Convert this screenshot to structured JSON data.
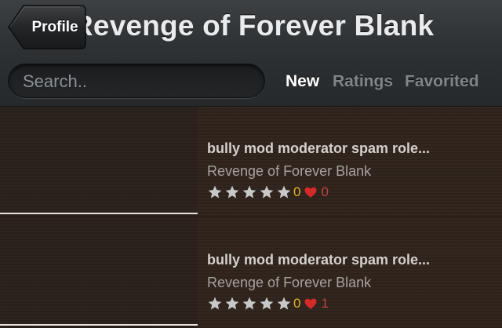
{
  "header": {
    "title": "Revenge of Forever Blank",
    "back_label": "Profile"
  },
  "search": {
    "placeholder": "Search.."
  },
  "tabs": [
    {
      "label": "New",
      "active": true
    },
    {
      "label": "Ratings",
      "active": false
    },
    {
      "label": "Favorited",
      "active": false
    }
  ],
  "items": [
    {
      "title": "bully mod moderator spam role...",
      "subtitle": "Revenge of Forever Blank",
      "stars": 5,
      "rating_count": "0",
      "favorites": "0"
    },
    {
      "title": "bully mod moderator spam role...",
      "subtitle": "Revenge of Forever Blank",
      "stars": 5,
      "rating_count": "0",
      "favorites": "1"
    }
  ],
  "colors": {
    "header_bg": "#2e3133",
    "list_bg": "#30241d",
    "rating_count": "#e2b322",
    "favorite_count": "#c0413f",
    "star": "#c8c8c8",
    "heart": "#d42a2a"
  }
}
